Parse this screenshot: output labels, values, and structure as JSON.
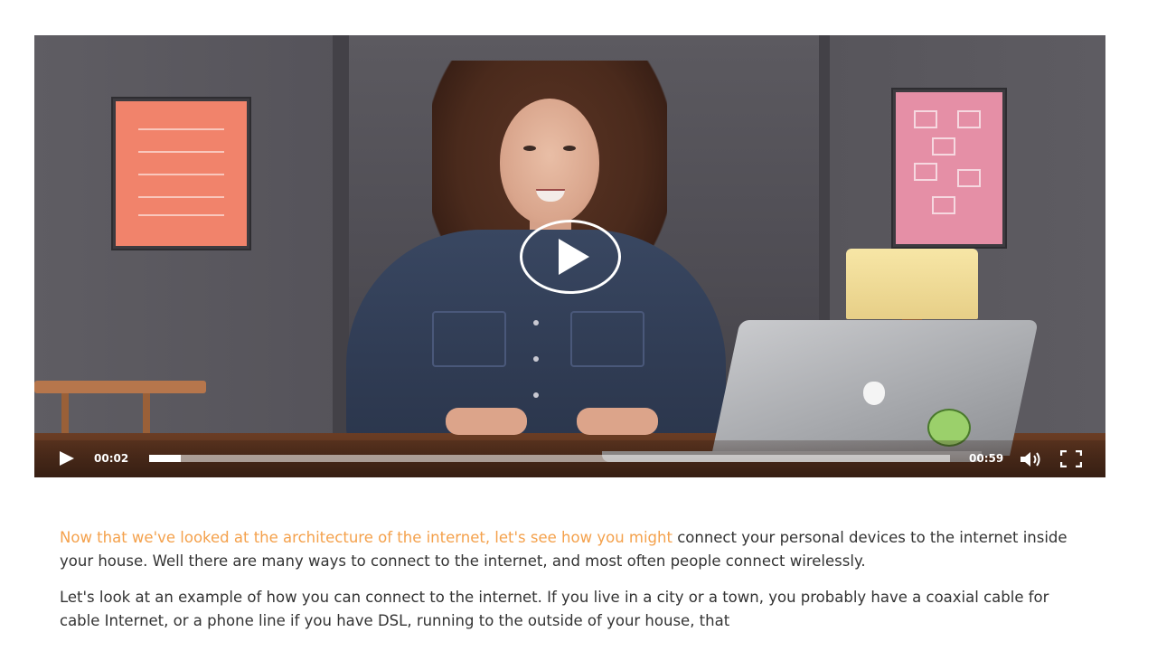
{
  "video": {
    "current_time": "00:02",
    "duration": "00:59",
    "progress": 0.04,
    "big_play_icon": "play-circle-icon",
    "play_icon": "play-icon",
    "volume_icon": "volume-icon",
    "fullscreen_icon": "fullscreen-icon"
  },
  "article": {
    "p1_highlight": "Now that we've looked at the architecture of the internet, let's see how you might",
    "p1_rest": " connect your personal devices to the internet inside your house. Well there are many ways to connect to the internet, and most often people connect wirelessly.",
    "p2": "Let's look at an example of how you can connect to the internet. If you live in a city or a town, you probably have a coaxial cable for cable Internet, or a phone line if you have DSL, running to the outside of your house, that"
  },
  "colors": {
    "highlight": "#f4a14c",
    "text": "#333333"
  }
}
